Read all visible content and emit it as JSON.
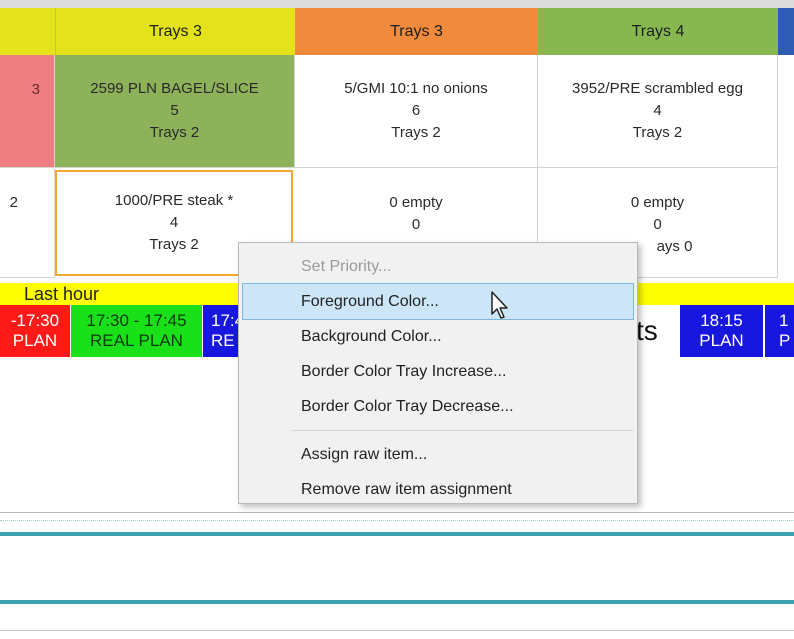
{
  "headers": [
    {
      "label": "",
      "color": "#e4e21b"
    },
    {
      "label": "Trays  3",
      "color": "#e4e21b"
    },
    {
      "label": "Trays  3",
      "color": "#f08a3c"
    },
    {
      "label": "Trays  4",
      "color": "#86b84f"
    },
    {
      "label": "",
      "color": "#2f5bb5"
    }
  ],
  "row1": [
    {
      "line1": "3",
      "line2": "",
      "line3": "",
      "color": "#ef7e80"
    },
    {
      "line1": "2599  PLN BAGEL/SLICE",
      "line2": "5",
      "line3": "Trays  2",
      "color": "#8db25a"
    },
    {
      "line1": "5/GMI  10:1 no onions",
      "line2": "6",
      "line3": "Trays  2",
      "color": "#ffffff"
    },
    {
      "line1": "3952/PRE  scrambled egg",
      "line2": "4",
      "line3": "Trays  2",
      "color": "#ffffff"
    }
  ],
  "row2": [
    {
      "line1": "2",
      "line2": "",
      "line3": ""
    },
    {
      "line1": "1000/PRE  steak *",
      "line2": "4",
      "line3": "Trays  2",
      "border": "#f0a830"
    },
    {
      "line1": "0  empty",
      "line2": "0",
      "line3": ""
    },
    {
      "line1": "0  empty",
      "line2": "0",
      "line3": "ays  0"
    }
  ],
  "last_hour": {
    "label": "Last hour",
    "color": "#ffff00"
  },
  "timeline": [
    {
      "line1": "-17:30",
      "line2": "PLAN",
      "color": "#ff1a1a",
      "text_color": "#ffffff"
    },
    {
      "line1": "17:30 - 17:45",
      "line2": "REAL PLAN",
      "color": "#19e019",
      "text_color": "#0a3a0a"
    },
    {
      "line1": "17:4",
      "line2": "RE",
      "color": "#1717e0",
      "text_color": "#ffffff"
    },
    {
      "line1": "ts",
      "line2": "",
      "color": "#ffffff",
      "text_color": "#111111"
    },
    {
      "line1": "18:15",
      "line2": "PLAN",
      "color": "#1717e0",
      "text_color": "#ffffff"
    },
    {
      "line1": "1",
      "line2": "P",
      "color": "#1717e0",
      "text_color": "#ffffff"
    }
  ],
  "menu": {
    "items": [
      {
        "label": "Set Priority...",
        "disabled": true
      },
      {
        "label": "Foreground Color...",
        "highlighted": true
      },
      {
        "label": "Background Color..."
      },
      {
        "label": "Border Color Tray Increase..."
      },
      {
        "label": "Border Color Tray Decrease..."
      },
      {
        "label": "Assign raw item..."
      },
      {
        "label": "Remove raw item assignment"
      }
    ]
  },
  "colors": {
    "accent_line": "#3aa0b0",
    "menu_highlight": "#cde6f7"
  }
}
